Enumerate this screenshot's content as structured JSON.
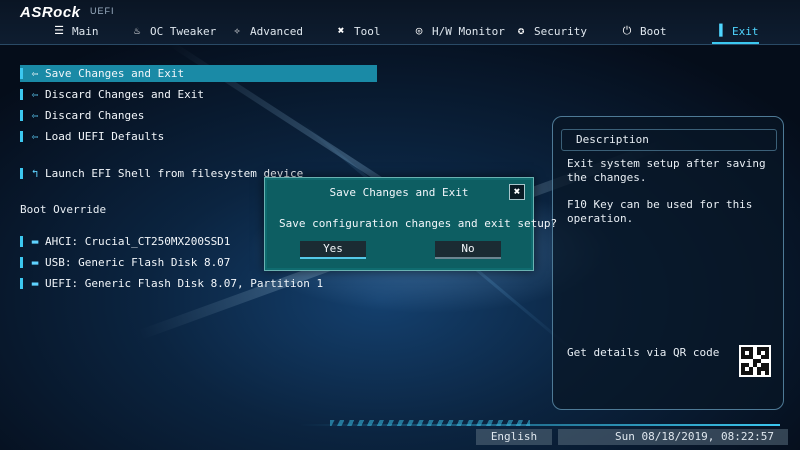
{
  "brand": {
    "name": "ASRock",
    "sub": "UEFI"
  },
  "tabs": [
    {
      "label": "Main",
      "icon": "list-icon",
      "active": false
    },
    {
      "label": "OC Tweaker",
      "icon": "flame-icon",
      "active": false
    },
    {
      "label": "Advanced",
      "icon": "star-icon",
      "active": false
    },
    {
      "label": "Tool",
      "icon": "tools-icon",
      "active": false
    },
    {
      "label": "H/W Monitor",
      "icon": "monitor-icon",
      "active": false
    },
    {
      "label": "Security",
      "icon": "shield-icon",
      "active": false
    },
    {
      "label": "Boot",
      "icon": "power-icon",
      "active": false
    },
    {
      "label": "Exit",
      "icon": "exit-icon",
      "active": true
    }
  ],
  "menu": {
    "items": [
      {
        "label": "Save Changes and Exit",
        "icon": "exit-icon",
        "selected": true
      },
      {
        "label": "Discard Changes and Exit",
        "icon": "exit-icon",
        "selected": false
      },
      {
        "label": "Discard Changes",
        "icon": "exit-icon",
        "selected": false
      },
      {
        "label": "Load UEFI Defaults",
        "icon": "exit-icon",
        "selected": false
      },
      {
        "label": "Launch EFI Shell from filesystem device",
        "icon": "launch-icon",
        "selected": false
      }
    ],
    "boot_override_label": "Boot Override",
    "boot_items": [
      {
        "label": "AHCI:  Crucial_CT250MX200SSD1",
        "icon": "folder-icon"
      },
      {
        "label": "USB: Generic Flash Disk 8.07",
        "icon": "folder-icon"
      },
      {
        "label": "UEFI: Generic Flash Disk 8.07, Partition 1",
        "icon": "folder-icon"
      }
    ]
  },
  "description": {
    "title": "Description",
    "line1": "Exit system setup after saving the changes.",
    "line2": "F10 Key can be used for this operation.",
    "qr_label": "Get details via QR code"
  },
  "dialog": {
    "title": "Save Changes and Exit",
    "message": "Save configuration changes and exit setup?",
    "yes": "Yes",
    "no": "No",
    "close_glyph": "✖"
  },
  "footer": {
    "language": "English",
    "datetime": "Sun 08/18/2019, 08:22:57"
  },
  "colors": {
    "accent": "#3cc8f0",
    "selection": "#1a8aa6",
    "dialog_bg": "#0d5e62"
  }
}
